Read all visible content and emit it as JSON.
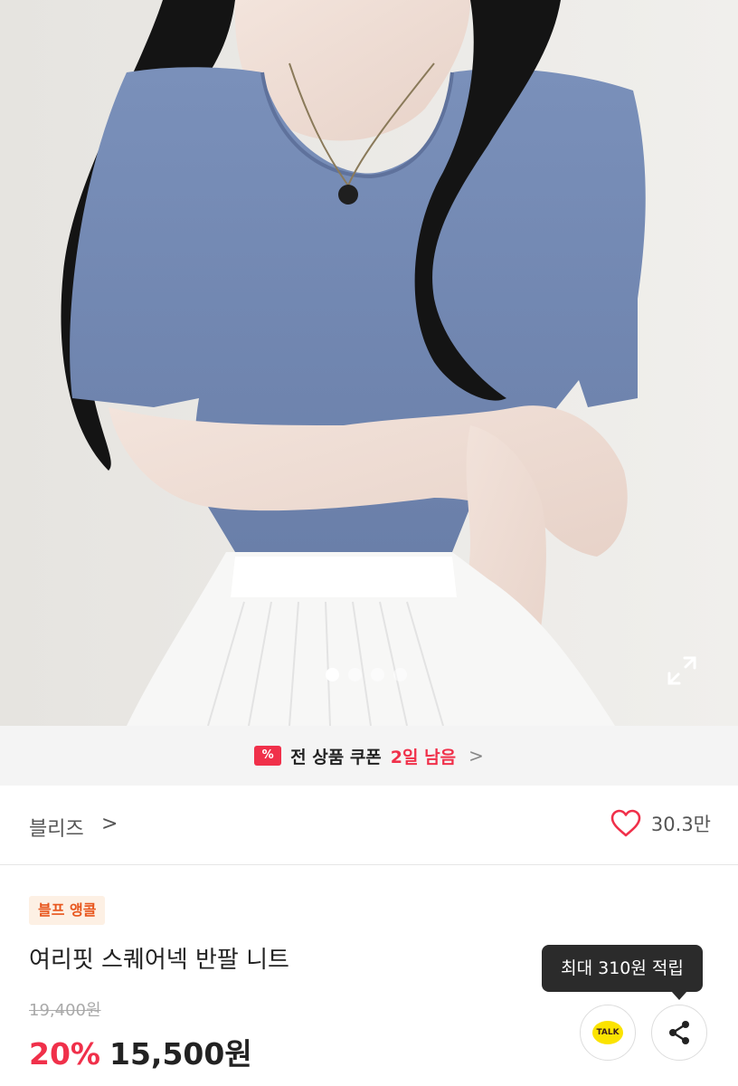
{
  "carousel": {
    "image_count": 4,
    "active_index": 0
  },
  "coupon": {
    "icon_symbol": "%",
    "label": "전 상품 쿠폰",
    "highlight": "2일 남음",
    "chevron": ">"
  },
  "store": {
    "name": "블리즈",
    "chevron": ">",
    "like_count": "30.3만"
  },
  "product": {
    "badge": "블프 앵콜",
    "name": "여리핏 스퀘어넥 반팔 니트",
    "original_price": "19,400원",
    "discount": "20%",
    "price": "15,500원"
  },
  "rewards": {
    "tooltip": "최대 310원 적립"
  },
  "actions": {
    "kakao_label": "TALK"
  },
  "colors": {
    "accent": "#f0304a",
    "badge_bg": "#fdf0e4",
    "badge_text": "#e8561d",
    "kakao": "#fbe300",
    "knit": "#7288b3"
  },
  "icons": [
    "expand-icon",
    "coupon-icon",
    "chevron-right-icon",
    "heart-icon",
    "kakao-talk-icon",
    "share-icon"
  ]
}
